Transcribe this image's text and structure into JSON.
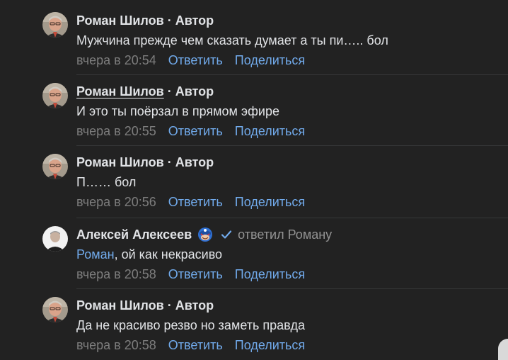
{
  "comments": [
    {
      "author": "Роман Шилов",
      "separator": "·",
      "role": "Автор",
      "text": "Мужчина прежде чем сказать думает а ты пи….. бол",
      "timestamp": "вчера в 20:54",
      "reply_label": "Ответить",
      "share_label": "Поделиться",
      "avatar": "author-photo"
    },
    {
      "author": "Роман Шилов",
      "separator": "·",
      "role": "Автор",
      "text": "И это ты поёрзал в прямом эфире",
      "timestamp": "вчера в 20:55",
      "reply_label": "Ответить",
      "share_label": "Поделиться",
      "avatar": "author-photo"
    },
    {
      "author": "Роман Шилов",
      "separator": "·",
      "role": "Автор",
      "text": "П…… бол",
      "timestamp": "вчера в 20:56",
      "reply_label": "Ответить",
      "share_label": "Поделиться",
      "avatar": "author-photo"
    },
    {
      "author": "Алексей Алексеев",
      "badge_icon": "superhero-emoji-icon",
      "verified_icon": "checkmark-icon",
      "reply_to": "ответил Роману",
      "mention": "Роман",
      "text": ", ой как некрасиво",
      "timestamp": "вчера в 20:58",
      "reply_label": "Ответить",
      "share_label": "Поделиться",
      "avatar": "user-photo"
    },
    {
      "author": "Роман Шилов",
      "separator": "·",
      "role": "Автор",
      "text": "Да не красиво резво но заметь правда",
      "timestamp": "вчера в 20:58",
      "reply_label": "Ответить",
      "share_label": "Поделиться",
      "avatar": "author-photo"
    }
  ],
  "colors": {
    "background": "#222222",
    "text": "#e1e3e6",
    "link": "#71aaeb",
    "muted": "#7d7d7d",
    "divider": "#363738"
  }
}
